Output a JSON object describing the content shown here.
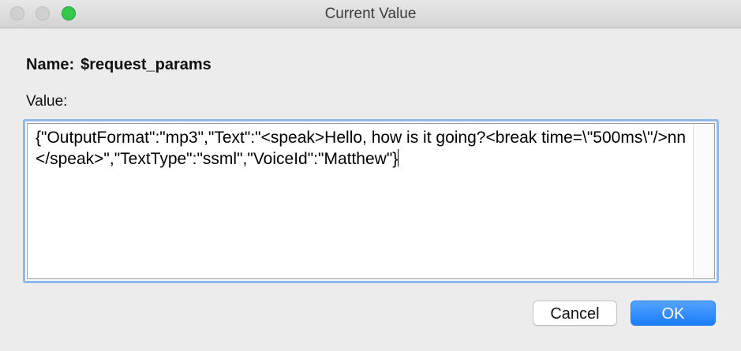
{
  "window": {
    "title": "Current Value"
  },
  "name_field": {
    "label": "Name:",
    "value": "$request_params"
  },
  "value_field": {
    "label": "Value:",
    "text": "{\"OutputFormat\":\"mp3\",\"Text\":\"<speak>Hello, how is it going?<break time=\\\"500ms\\\"/>nn</speak>\",\"TextType\":\"ssml\",\"VoiceId\":\"Matthew\"}"
  },
  "buttons": {
    "cancel_label": "Cancel",
    "ok_label": "OK"
  },
  "colors": {
    "accent": "#1a7dfa",
    "focus_ring": "#8fb8ea",
    "zoom_button": "#35c84a"
  }
}
